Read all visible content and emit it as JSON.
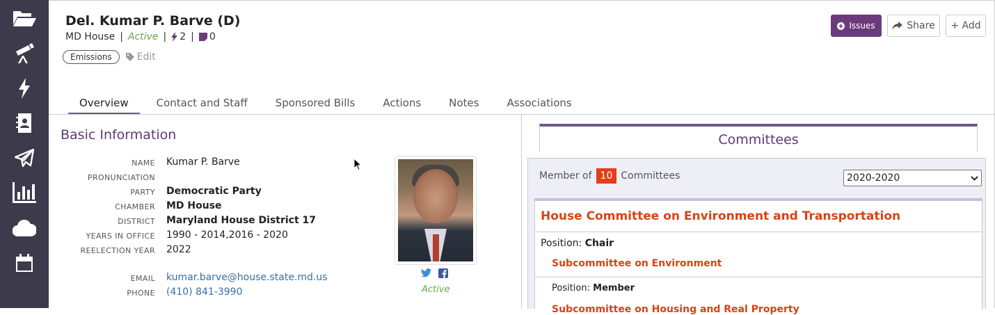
{
  "sidebar": {
    "icons": [
      "folder-open-icon",
      "telescope-icon",
      "bolt-icon",
      "address-book-icon",
      "paper-plane-icon",
      "bar-chart-icon",
      "cloud-icon",
      "calendar-icon"
    ]
  },
  "header": {
    "title": "Del. Kumar P. Barve (D)",
    "chamber": "MD House",
    "status": "Active",
    "bolt_count": "2",
    "note_count": "0",
    "separator": "|",
    "tag": "Emissions",
    "edit_label": "Edit"
  },
  "actions": {
    "issues_label": "Issues",
    "share_label": "Share",
    "add_label": "+ Add"
  },
  "tabs": [
    {
      "label": "Overview",
      "active": true
    },
    {
      "label": "Contact and Staff"
    },
    {
      "label": "Sponsored Bills"
    },
    {
      "label": "Actions"
    },
    {
      "label": "Notes"
    },
    {
      "label": "Associations"
    }
  ],
  "basic_info": {
    "title": "Basic Information",
    "fields": [
      {
        "label": "NAME",
        "value": "Kumar P. Barve"
      },
      {
        "label": "PRONUNCIATION",
        "value": ""
      },
      {
        "label": "PARTY",
        "value": "Democratic Party"
      },
      {
        "label": "CHAMBER",
        "value": "MD House"
      },
      {
        "label": "DISTRICT",
        "value": "Maryland House District 17"
      },
      {
        "label": "YEARS IN OFFICE",
        "value": "1990 - 2014,2016 - 2020"
      },
      {
        "label": "REELECTION YEAR",
        "value": "2022"
      },
      {
        "label": "EMAIL",
        "value": "kumar.barve@house.state.md.us"
      },
      {
        "label": "PHONE",
        "value": "(410) 841-3990"
      }
    ],
    "status": "Active"
  },
  "committees": {
    "title": "Committees",
    "member_prefix": "Member of",
    "member_count": "10",
    "member_suffix": "Committees",
    "year": "2020-2020",
    "items": [
      {
        "name": "House Committee on Environment and Transportation",
        "position_label": "Position:",
        "position": "Chair",
        "subcommittees": [
          {
            "name": "Subcommittee on Environment",
            "position_label": "Position:",
            "position": "Member"
          },
          {
            "name": "Subcommittee on Housing and Real Property"
          }
        ]
      }
    ]
  }
}
